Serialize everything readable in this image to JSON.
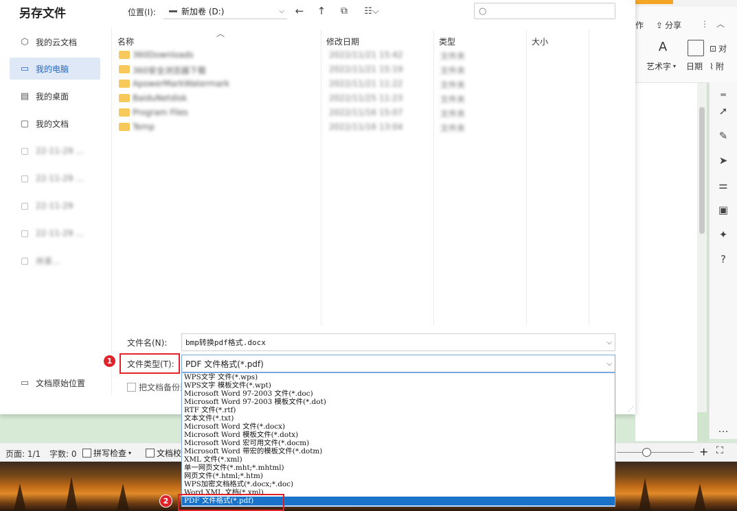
{
  "dialog": {
    "title": "另存文件",
    "location_label": "位置(I):",
    "location_value": "新加卷 (D:)",
    "search_placeholder": ""
  },
  "sidebar": {
    "items": [
      {
        "label": "我的云文档",
        "icon": "cloud-icon"
      },
      {
        "label": "我的电脑",
        "icon": "computer-icon"
      },
      {
        "label": "我的桌面",
        "icon": "desktop-icon"
      },
      {
        "label": "我的文档",
        "icon": "document-icon"
      },
      {
        "label": "22-11-29 ...",
        "icon": "folder-icon"
      },
      {
        "label": "22-11-29 ...",
        "icon": "folder-icon"
      },
      {
        "label": "22-11-29",
        "icon": "folder-icon"
      },
      {
        "label": "22-11-29 ...",
        "icon": "folder-icon"
      },
      {
        "label": "共享...",
        "icon": "folder-icon"
      }
    ],
    "bottom_label": "文档原始位置"
  },
  "filelist": {
    "headers": {
      "name": "名称",
      "date": "修改日期",
      "type": "类型",
      "size": "大小"
    },
    "rows": [
      {
        "name": "360Downloads",
        "date": "2022/11/21 15:42",
        "type": "文件夹"
      },
      {
        "name": "360安全浏览器下载",
        "date": "2022/11/21 15:19",
        "type": "文件夹"
      },
      {
        "name": "ApowerMarkWatermark",
        "date": "2022/11/21 11:22",
        "type": "文件夹"
      },
      {
        "name": "BaiduNetdisk",
        "date": "2022/11/25 11:23",
        "type": "文件夹"
      },
      {
        "name": "Program Files",
        "date": "2022/11/16 15:07",
        "type": "文件夹"
      },
      {
        "name": "Temp",
        "date": "2022/11/16 13:04",
        "type": "文件夹"
      }
    ]
  },
  "form": {
    "filename_label": "文件名(N):",
    "filename_value": "bmp转换pdf格式.docx",
    "filetype_label": "文件类型(T):",
    "filetype_value": "PDF 文件格式(*.pdf)",
    "backup_label": "把文档备份到"
  },
  "dropdown": {
    "options": [
      "WPS文字 文件(*.wps)",
      "WPS文字 模板文件(*.wpt)",
      "Microsoft Word 97-2003 文件(*.doc)",
      "Microsoft Word 97-2003 模板文件(*.dot)",
      "RTF 文件(*.rtf)",
      "文本文件(*.txt)",
      "Microsoft Word 文件(*.docx)",
      "Microsoft Word 模板文件(*.dotx)",
      "Microsoft Word 宏可用文件(*.docm)",
      "Microsoft Word 带宏的模板文件(*.dotm)",
      "XML 文件(*.xml)",
      "单一网页文件(*.mht;*.mhtml)",
      "网页文件(*.html;*.htm)",
      "WPS加密文档格式(*.docx;*.doc)",
      "Word XML 文档(*.xml)",
      "PDF 文件格式(*.pdf)"
    ],
    "selected": "PDF 文件格式(*.pdf)"
  },
  "annotations": {
    "badge1": "1",
    "badge2": "2"
  },
  "app": {
    "share_label": "分享",
    "collab_label": "作",
    "art_text_label": "艺术字",
    "date_label": "日期",
    "obj_label": "对",
    "attach_label": "附"
  },
  "statusbar": {
    "page": "页面: 1/1",
    "words": "字数: 0",
    "spellcheck": "拼写检查",
    "doccheck": "文档校"
  },
  "colors": {
    "accent": "#1a73c9",
    "highlight": "#e0232a",
    "selected_bg": "#dfe8f6"
  }
}
